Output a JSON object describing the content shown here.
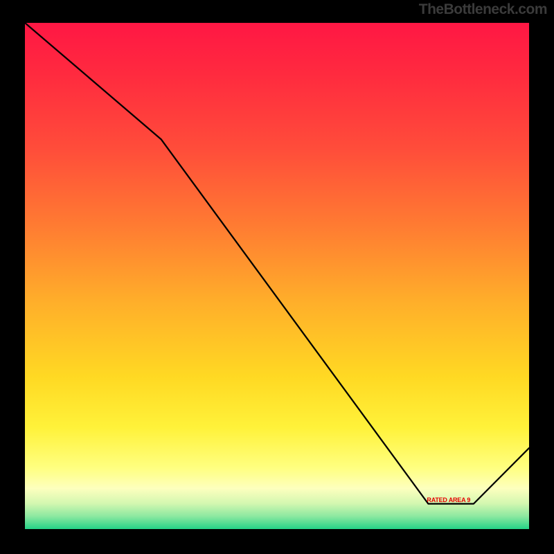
{
  "attribution": "TheBottleneck.com",
  "label_text": "RATED AREA 9",
  "chart_data": {
    "type": "line",
    "title": "",
    "xlabel": "",
    "ylabel": "",
    "xlim": [
      0,
      100
    ],
    "ylim": [
      0,
      100
    ],
    "series": [
      {
        "name": "curve",
        "x": [
          0,
          27,
          80,
          89,
          100
        ],
        "y": [
          100,
          77,
          5,
          5,
          16
        ]
      }
    ],
    "gradient_stops": [
      {
        "pos": 0.0,
        "color": "#ff1744"
      },
      {
        "pos": 0.1,
        "color": "#ff2a3f"
      },
      {
        "pos": 0.25,
        "color": "#ff4d3a"
      },
      {
        "pos": 0.4,
        "color": "#ff7b32"
      },
      {
        "pos": 0.55,
        "color": "#ffae2a"
      },
      {
        "pos": 0.7,
        "color": "#ffd923"
      },
      {
        "pos": 0.8,
        "color": "#fff23a"
      },
      {
        "pos": 0.88,
        "color": "#ffff81"
      },
      {
        "pos": 0.92,
        "color": "#fdffbe"
      },
      {
        "pos": 0.95,
        "color": "#d2f7b0"
      },
      {
        "pos": 0.975,
        "color": "#8be8a0"
      },
      {
        "pos": 1.0,
        "color": "#24d387"
      }
    ],
    "label_marker": {
      "x_start": 80,
      "x_end": 89,
      "y": 5,
      "text": "RATED AREA 9"
    }
  }
}
